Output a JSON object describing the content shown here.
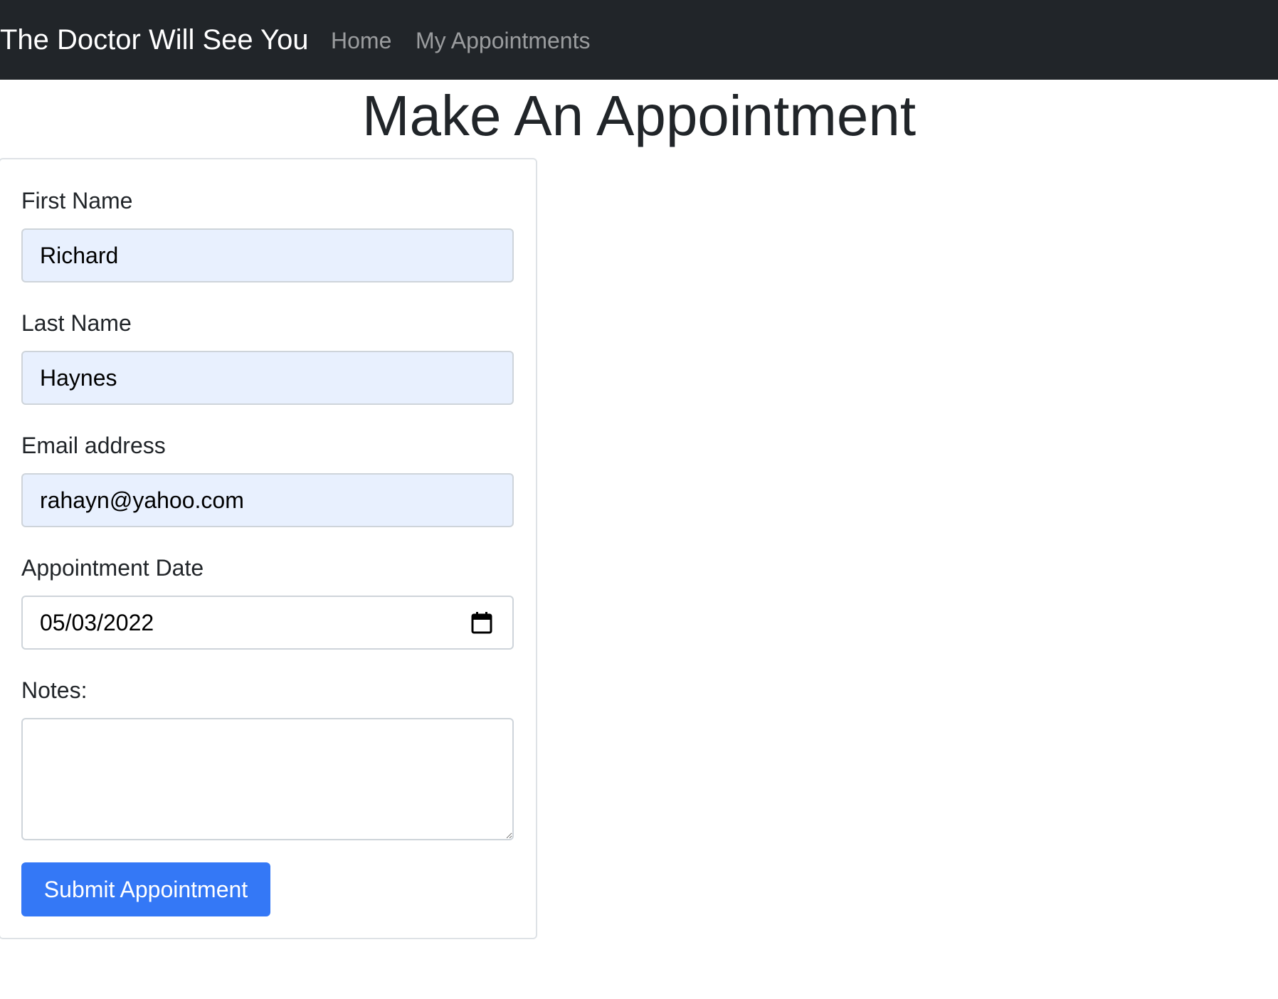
{
  "navbar": {
    "brand": "The Doctor Will See You",
    "links": [
      {
        "label": "Home"
      },
      {
        "label": "My Appointments"
      }
    ]
  },
  "main": {
    "title": "Make An Appointment"
  },
  "form": {
    "first_name": {
      "label": "First Name",
      "value": "Richard"
    },
    "last_name": {
      "label": "Last Name",
      "value": "Haynes"
    },
    "email": {
      "label": "Email address",
      "value": "rahayn@yahoo.com"
    },
    "date": {
      "label": "Appointment Date",
      "value": "05/03/2022",
      "icon": "calendar-icon"
    },
    "notes": {
      "label": "Notes:",
      "value": ""
    },
    "submit_label": "Submit Appointment"
  },
  "colors": {
    "navbar_bg": "#212529",
    "autofill_bg": "#e8f0fe",
    "primary": "#3478f6"
  }
}
